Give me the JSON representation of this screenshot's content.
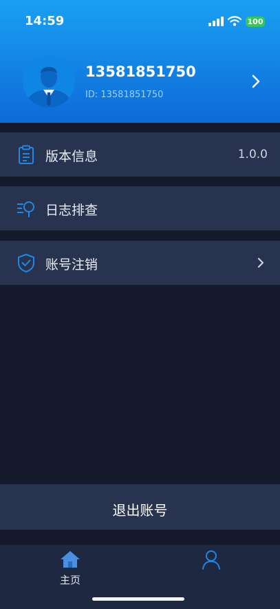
{
  "status_bar": {
    "time": "14:59",
    "battery": "100"
  },
  "profile": {
    "phone": "13581851750",
    "id": "ID: 13581851750"
  },
  "menu": [
    {
      "label": "版本信息",
      "value": "1.0.0",
      "icon": "clipboard-icon"
    },
    {
      "label": "日志排查",
      "value": "",
      "icon": "log-search-icon"
    },
    {
      "label": "账号注销",
      "value": "",
      "icon": "shield-check-icon"
    }
  ],
  "logout": {
    "label": "退出账号"
  },
  "tabs": [
    {
      "label": "主页",
      "icon": "home-icon"
    },
    {
      "label": "",
      "icon": "user-icon"
    }
  ],
  "colors": {
    "header_top": "#1aa0f2",
    "header_bottom": "#0d6ad8",
    "background": "#141a2c",
    "row": "#283350",
    "accent": "#1e88e5"
  }
}
